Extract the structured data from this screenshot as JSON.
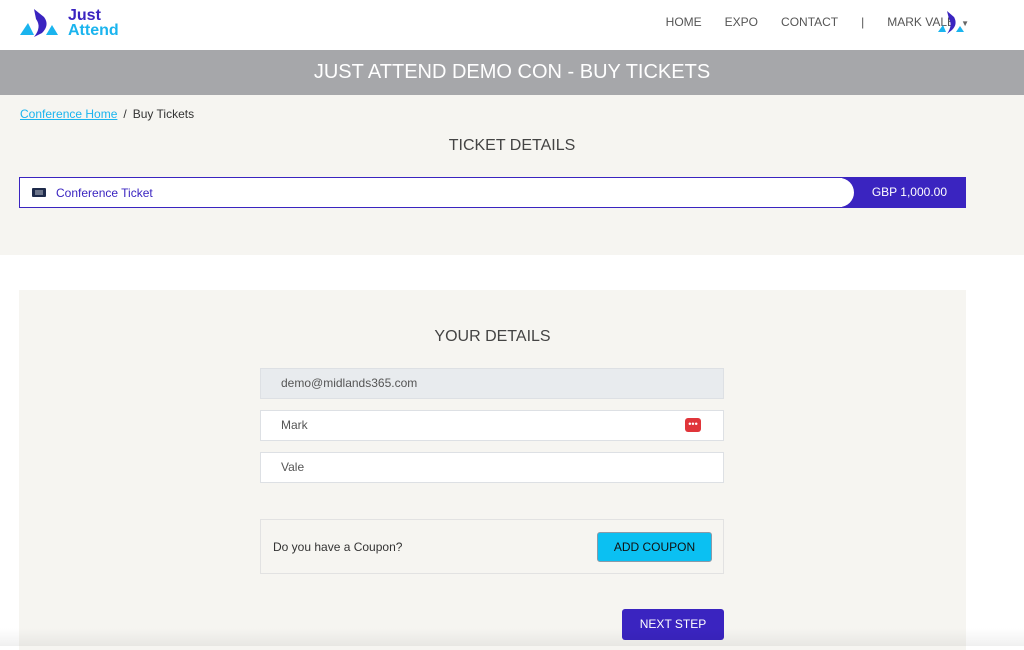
{
  "header": {
    "logo_line1": "Just",
    "logo_line2": "Attend",
    "nav": [
      "HOME",
      "EXPO",
      "CONTACT",
      "|",
      "MARK VALE"
    ],
    "user_menu_icon": "caret-down-icon"
  },
  "banner": {
    "title": "JUST ATTEND DEMO CON - BUY TICKETS"
  },
  "breadcrumb": {
    "home": "Conference Home",
    "separator": "/",
    "current": "Buy Tickets"
  },
  "ticket_section": {
    "heading": "TICKET DETAILS",
    "ticket": {
      "icon": "ticket-icon",
      "name": "Conference Ticket",
      "price": "GBP 1,000.00"
    }
  },
  "details_section": {
    "heading": "YOUR DETAILS",
    "email": "demo@midlands365.com",
    "first_name": "Mark",
    "last_name": "Vale",
    "password_manager_icon": "lastpass-icon",
    "coupon_question": "Do you have a Coupon?",
    "add_coupon_label": "ADD COUPON",
    "next_label": "NEXT STEP"
  },
  "colors": {
    "brand": "#3a24c0",
    "accent": "#1ab4ee",
    "coupon": "#0bc0f2",
    "banner": "#a6a7aa"
  }
}
